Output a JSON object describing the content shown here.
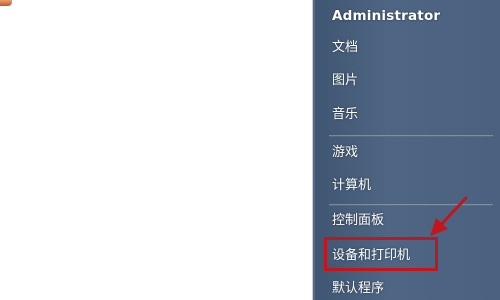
{
  "start_menu": {
    "user_name": "Administrator",
    "items": [
      {
        "label": "文档"
      },
      {
        "label": "图片"
      },
      {
        "label": "音乐"
      },
      {
        "label": "游戏"
      },
      {
        "label": "计算机"
      },
      {
        "label": "控制面板"
      },
      {
        "label": "设备和打印机"
      },
      {
        "label": "默认程序"
      }
    ]
  },
  "annotation": {
    "color": "#c4151c",
    "icon": "arrow-icon"
  }
}
